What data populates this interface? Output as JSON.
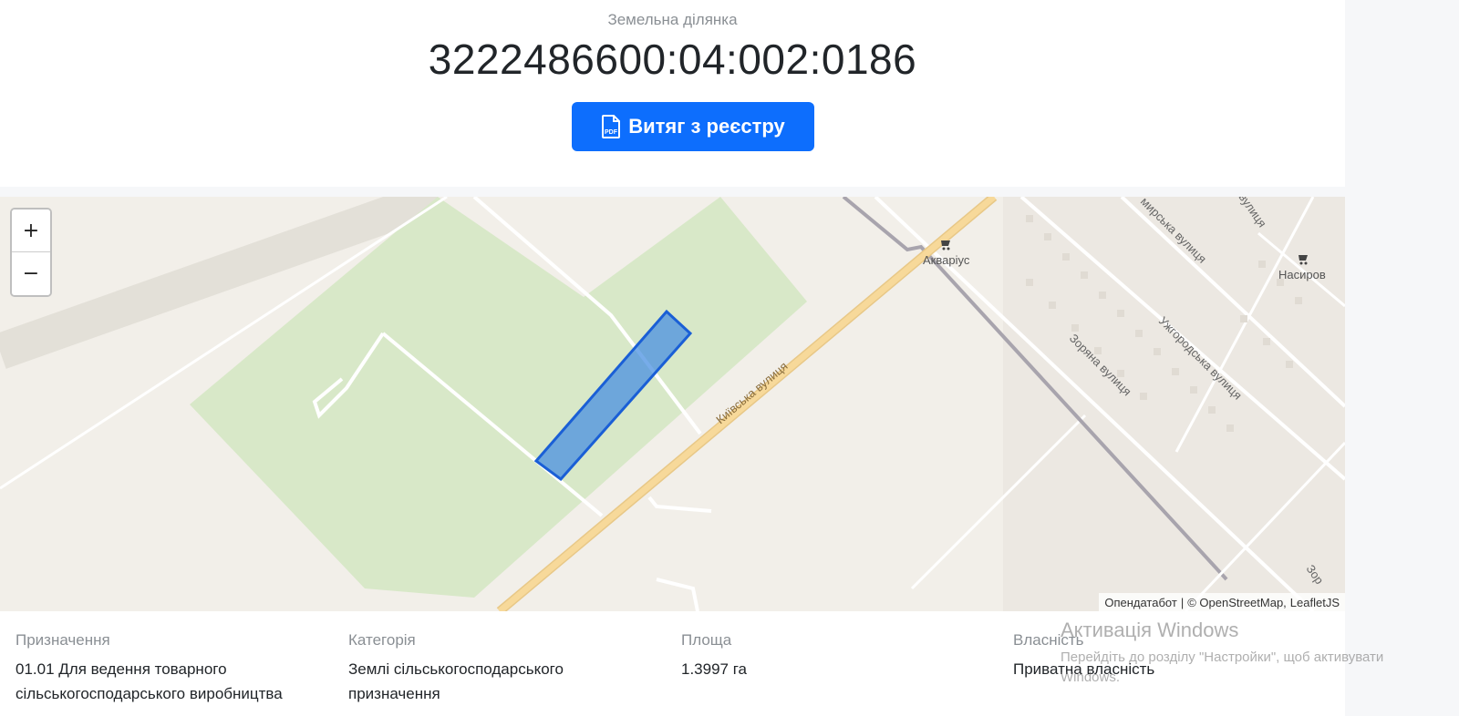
{
  "header": {
    "subtitle": "Земельна ділянка",
    "cadastral_number": "3222486600:04:002:0186",
    "extract_button_label": "Витяг з реєстру"
  },
  "map": {
    "zoom_in_label": "+",
    "zoom_out_label": "−",
    "labels": {
      "street_kyivska": "Київська вулиця",
      "street_zoriana": "Зоряна вулиця",
      "street_uzhhorodska": "Ужгородська вулиця",
      "street_mirska": "мирська вулиця",
      "street_top": "вулиця",
      "street_zor_edge": "Зор",
      "shop_akvarius": "Акваріус",
      "shop_nasyrov": "Насиров"
    },
    "attribution": {
      "owner": "Опендатабот",
      "separator": "|",
      "osm": "© OpenStreetMap,",
      "leaflet": "LeafletJS"
    },
    "colors": {
      "park": "#d8e8c8",
      "parcel": "#4a90e2",
      "parcel_stroke": "#1a5fd6",
      "road_major": "#f7d99a",
      "railway": "#a8a4ad"
    }
  },
  "info": {
    "purpose_label": "Призначення",
    "purpose_value_line1": "01.01 Для ведення товарного",
    "purpose_value_line2": "сільськогосподарського виробництва",
    "category_label": "Категорія",
    "category_value_line1": "Землі сільськогосподарського",
    "category_value_line2": "призначення",
    "area_label": "Площа",
    "area_value": "1.3997 га",
    "ownership_label": "Власність",
    "ownership_value": "Приватна власність"
  },
  "watermark": {
    "title": "Активація Windows",
    "line1": "Перейдіть до розділу \"Настройки\", щоб активувати",
    "line2": "Windows."
  },
  "icons": {
    "extract_button": "pdf-file-icon",
    "shop": "shop-cart-icon"
  }
}
